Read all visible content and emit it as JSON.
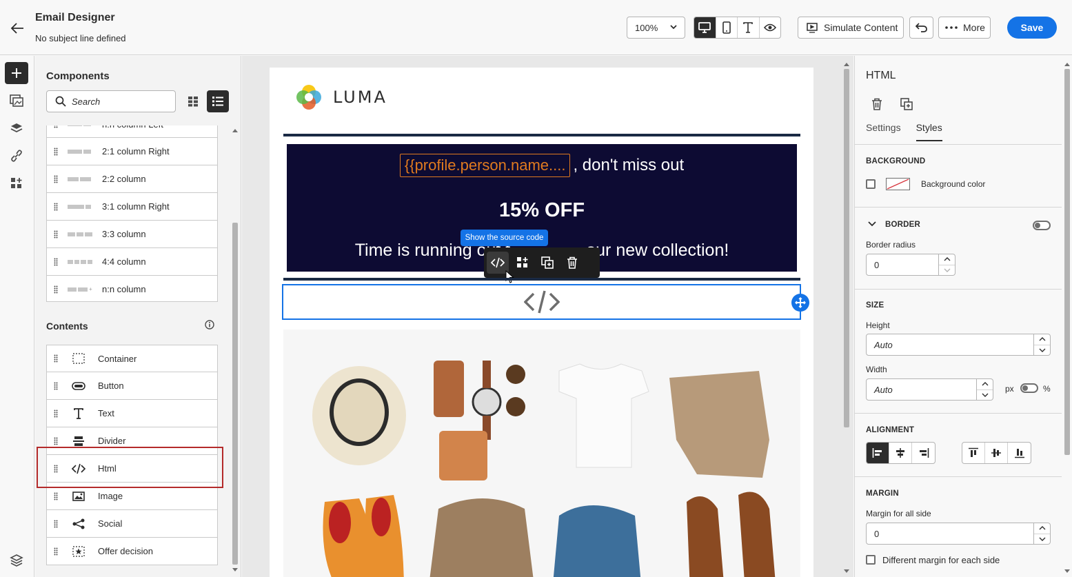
{
  "header": {
    "title": "Email Designer",
    "subtitle": "No subject line defined",
    "zoom": "100%",
    "simulate_label": "Simulate Content",
    "more_label": "More",
    "save_label": "Save"
  },
  "components": {
    "title": "Components",
    "search_placeholder": "Search",
    "structures": [
      {
        "label": "n:n column Left"
      },
      {
        "label": "2:1 column Right"
      },
      {
        "label": "2:2 column"
      },
      {
        "label": "3:1 column Right"
      },
      {
        "label": "3:3 column"
      },
      {
        "label": "4:4 column"
      },
      {
        "label": "n:n column"
      }
    ],
    "contents_title": "Contents",
    "contents": [
      {
        "label": "Container",
        "icon": "container-icon"
      },
      {
        "label": "Button",
        "icon": "button-icon"
      },
      {
        "label": "Text",
        "icon": "text-icon"
      },
      {
        "label": "Divider",
        "icon": "divider-icon"
      },
      {
        "label": "Html",
        "icon": "html-icon"
      },
      {
        "label": "Image",
        "icon": "image-icon"
      },
      {
        "label": "Social",
        "icon": "social-icon"
      },
      {
        "label": "Offer decision",
        "icon": "offer-decision-icon"
      }
    ]
  },
  "canvas": {
    "logo_text": "LUMA",
    "personalization_token": "{{profile.person.name....",
    "headline_suffix": ", don't miss out",
    "offer": "15% OFF",
    "line3_left": "Time is running out t",
    "line3_right": "our new collection!",
    "tooltip": "Show the source code"
  },
  "properties": {
    "title": "HTML",
    "tabs": [
      "Settings",
      "Styles"
    ],
    "active_tab": "Styles",
    "background": {
      "heading": "BACKGROUND",
      "label": "Background color"
    },
    "border": {
      "heading": "BORDER",
      "radius_label": "Border radius",
      "radius_value": "0"
    },
    "size": {
      "heading": "SIZE",
      "height_label": "Height",
      "height_value": "Auto",
      "width_label": "Width",
      "width_value": "Auto",
      "unit_px": "px",
      "unit_pct": "%"
    },
    "alignment": {
      "heading": "ALIGNMENT"
    },
    "margin": {
      "heading": "MARGIN",
      "all_label": "Margin for all side",
      "all_value": "0",
      "different_label": "Different margin for each side"
    }
  },
  "colors": {
    "accent": "#1473e6",
    "banner": "#0d0b33",
    "token": "#e07a1f",
    "highlight": "#b42a2a"
  }
}
